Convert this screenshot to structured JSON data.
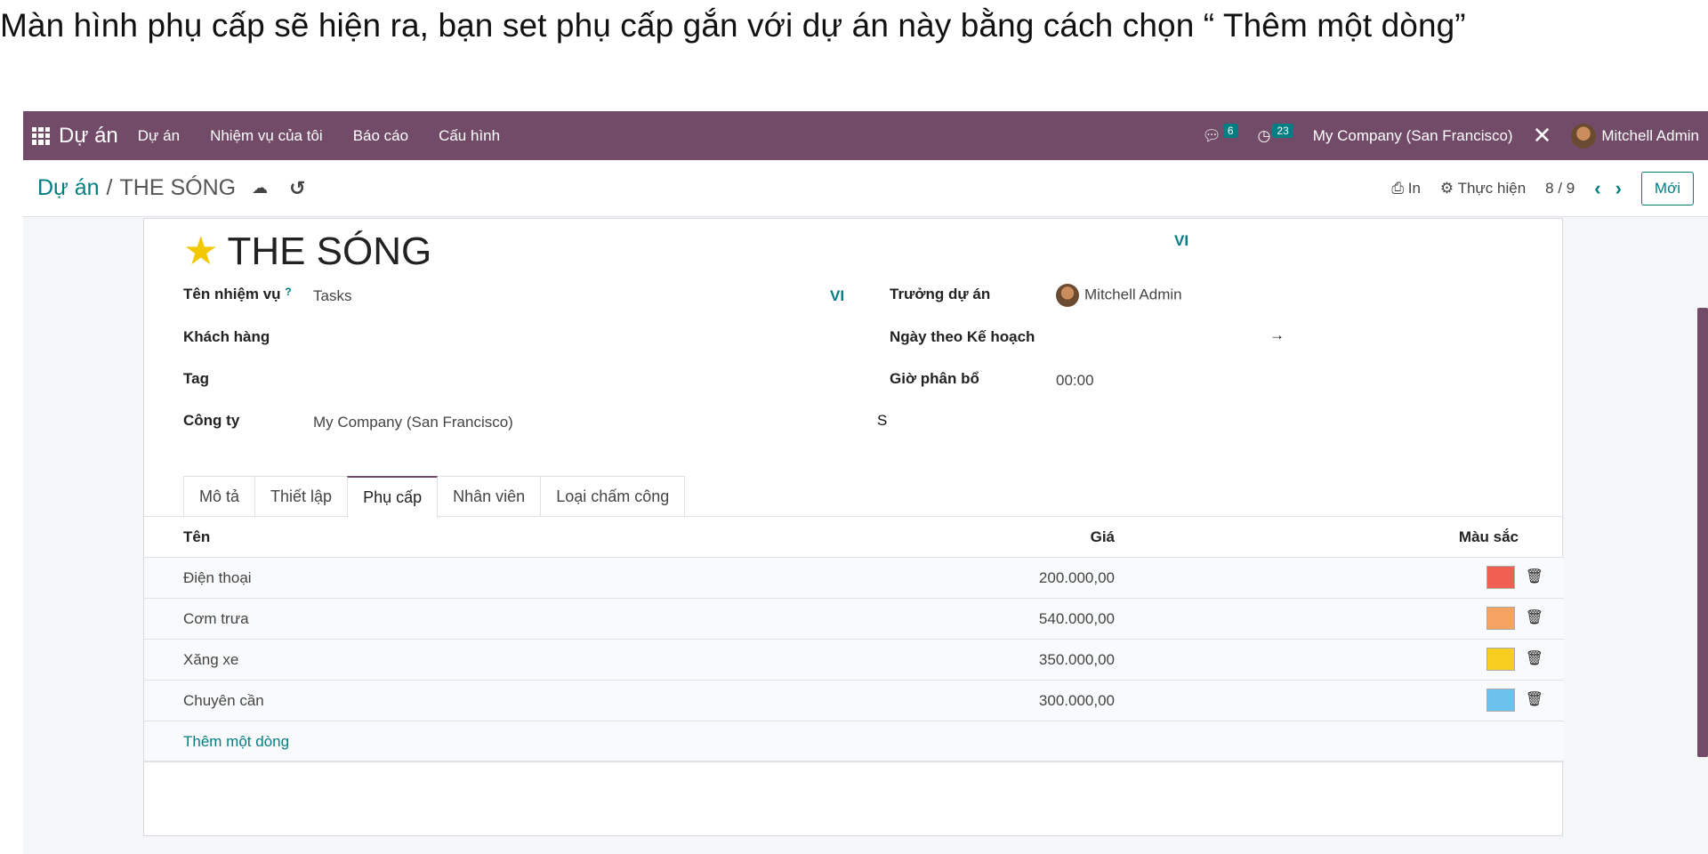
{
  "caption": "Màn hình phụ cấp sẽ hiện ra, bạn set phụ cấp gắn với dự án này bằng cách  chọn “ Thêm một dòng”",
  "navbar": {
    "app_name": "Dự án",
    "menu": [
      "Dự án",
      "Nhiệm vụ của tôi",
      "Báo cáo",
      "Cấu hình"
    ],
    "messages_count": "6",
    "activities_count": "23",
    "company": "My Company (San Francisco)",
    "user": "Mitchell Admin"
  },
  "control": {
    "breadcrumb_parent": "Dự án",
    "breadcrumb_sep": "/",
    "breadcrumb_current": "THE SÓNG",
    "print_label": "In",
    "action_label": "Thực hiện",
    "pager": "8 / 9",
    "new_label": "Mới"
  },
  "form": {
    "lang_top": "VI",
    "title": "THE SÓNG",
    "fields": {
      "task_name_label": "Tên nhiệm vụ",
      "task_name_help": "?",
      "task_name_value": "Tasks",
      "task_name_lang": "VI",
      "customer_label": "Khách hàng",
      "tag_label": "Tag",
      "company_label": "Công ty",
      "company_value": "My Company (San Francisco)",
      "stray_text": "S",
      "manager_label": "Trưởng dự án",
      "manager_value": "Mitchell Admin",
      "planned_date_label": "Ngày theo Kế hoạch",
      "date_arrow": "→",
      "allocated_hours_label": "Giờ phân bổ",
      "allocated_hours_value": "00:00"
    },
    "tabs": [
      "Mô tả",
      "Thiết lập",
      "Phụ cấp",
      "Nhân viên",
      "Loại chấm công"
    ],
    "active_tab": "Phụ cấp"
  },
  "allowance_table": {
    "headers": {
      "name": "Tên",
      "price": "Giá",
      "color": "Màu sắc"
    },
    "rows": [
      {
        "name": "Điện thoại",
        "price": "200.000,00",
        "color": "#f06050"
      },
      {
        "name": "Cơm trưa",
        "price": "540.000,00",
        "color": "#f4a460"
      },
      {
        "name": "Xăng xe",
        "price": "350.000,00",
        "color": "#f7cd1f"
      },
      {
        "name": "Chuyên cần",
        "price": "300.000,00",
        "color": "#6cc1ed"
      }
    ],
    "add_line": "Thêm một dòng"
  },
  "colors": {
    "brand": "#714b67",
    "accent": "#017e84"
  }
}
